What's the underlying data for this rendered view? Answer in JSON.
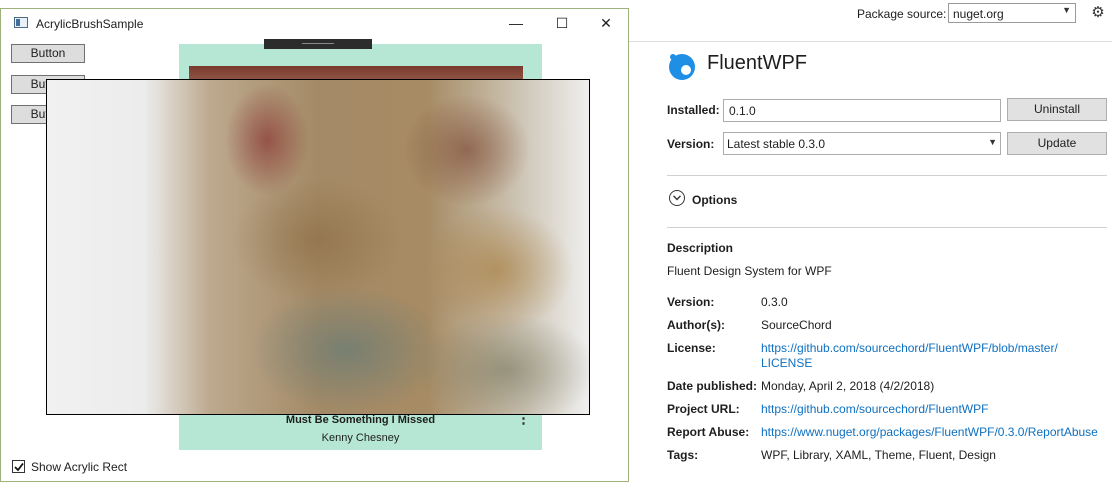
{
  "package_source": {
    "label": "Package source:",
    "value": "nuget.org"
  },
  "package": {
    "name": "FluentWPF"
  },
  "installed": {
    "label": "Installed:",
    "value": "0.1.0",
    "button": "Uninstall"
  },
  "version_row": {
    "label": "Version:",
    "value": "Latest stable 0.3.0",
    "button": "Update"
  },
  "options": {
    "label": "Options"
  },
  "description": {
    "heading": "Description",
    "text": "Fluent Design System for WPF"
  },
  "meta": {
    "version": {
      "label": "Version:",
      "value": "0.3.0"
    },
    "authors": {
      "label": "Author(s):",
      "value": "SourceChord"
    },
    "license": {
      "label": "License:",
      "value": "https://github.com/sourcechord/FluentWPF/blob/master/\nLICENSE"
    },
    "date": {
      "label": "Date published:",
      "value": "Monday, April 2, 2018 (4/2/2018)"
    },
    "project_url": {
      "label": "Project URL:",
      "value": "https://github.com/sourcechord/FluentWPF"
    },
    "report_abuse": {
      "label": "Report Abuse:",
      "value": "https://www.nuget.org/packages/FluentWPF/0.3.0/ReportAbuse"
    },
    "tags": {
      "label": "Tags:",
      "value": "WPF, Library, XAML, Theme, Fluent, Design"
    }
  },
  "window": {
    "title": "AcrylicBrushSample",
    "buttons": [
      "Button",
      "Button",
      "Button"
    ],
    "song_title": "Must Be Something I Missed",
    "song_artist": "Kenny Chesney",
    "checkbox": {
      "label": "Show Acrylic Rect",
      "checked": true
    }
  },
  "colors": {
    "link": "#0e70c0",
    "card_bg": "#b6e7d5",
    "window_border": "#9fb27c"
  },
  "icons": [
    "gear-icon",
    "chevron-down-icon",
    "package-logo-icon",
    "minimize-icon",
    "maximize-icon",
    "close-icon",
    "more-icon",
    "checkmark-icon",
    "app-icon"
  ]
}
